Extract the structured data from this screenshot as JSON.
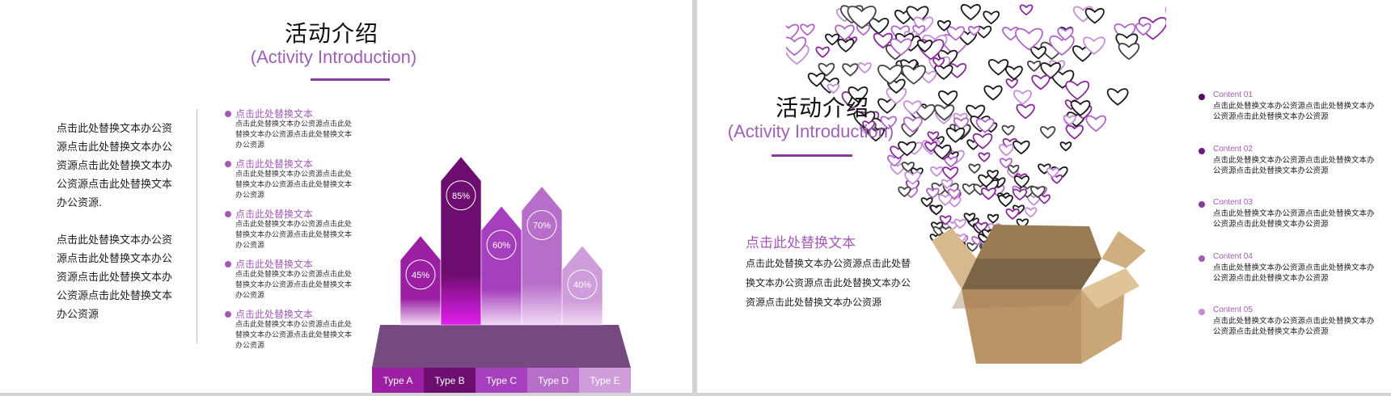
{
  "left_slide": {
    "title_cn": "活动介绍",
    "title_en": "(Activity Introduction)",
    "left_paragraphs": [
      "点击此处替换文本办公资源点击此处替换文本办公资源点击此处替换文本办公资源点击此处替换文本办公资源.",
      "点击此处替换文本办公资源点击此处替换文本办公资源点击此处替换文本办公资源点击此处替换文本办公资源"
    ],
    "bullets": [
      {
        "heading": "点击此处替换文本",
        "body": "点击此处替换文本办公资源点击此处替换文本办公资源点击此处替换文本办公资源"
      },
      {
        "heading": "点击此处替换文本",
        "body": "点击此处替换文本办公资源点击此处替换文本办公资源点击此处替换文本办公资源"
      },
      {
        "heading": "点击此处替换文本",
        "body": "点击此处替换文本办公资源点击此处替换文本办公资源点击此处替换文本办公资源"
      },
      {
        "heading": "点击此处替换文本",
        "body": "点击此处替换文本办公资源点击此处替换文本办公资源点击此处替换文本办公资源"
      },
      {
        "heading": "点击此处替换文本",
        "body": "点击此处替换文本办公资源点击此处替换文本办公资源点击此处替换文本办公资源"
      }
    ]
  },
  "chart_data": {
    "type": "bar",
    "categories": [
      "Type A",
      "Type B",
      "Type C",
      "Type D",
      "Type E"
    ],
    "values": [
      45,
      85,
      60,
      70,
      40
    ],
    "value_labels": [
      "45%",
      "85%",
      "60%",
      "70%",
      "40%"
    ],
    "ylim": [
      0,
      100
    ],
    "grid": false,
    "colors": [
      "#9b1fa3",
      "#6d0d6f",
      "#a53fbd",
      "#b76ec9",
      "#cf9dd9"
    ]
  },
  "right_slide": {
    "title_cn": "活动介绍",
    "title_en": "(Activity Introduction)",
    "sub_heading": "点击此处替换文本",
    "sub_body": "点击此处替换文本办公资源点击此处替换文本办公资源点击此处替换文本办公资源点击此处替换文本办公资源",
    "contents": [
      {
        "title": "Content 01",
        "body": "点击此处替换文本办公资源点击此处替换文本办公资源点击此处替换文本办公资源",
        "color": "#5a0a66"
      },
      {
        "title": "Content 02",
        "body": "点击此处替换文本办公资源点击此处替换文本办公资源点击此处替换文本办公资源",
        "color": "#6f1a7f"
      },
      {
        "title": "Content 03",
        "body": "点击此处替换文本办公资源点击此处替换文本办公资源点击此处替换文本办公资源",
        "color": "#8a3a9a"
      },
      {
        "title": "Content 04",
        "body": "点击此处替换文本办公资源点击此处替换文本办公资源点击此处替换文本办公资源",
        "color": "#a25cb4"
      },
      {
        "title": "Content 05",
        "body": "点击此处替换文本办公资源点击此处替换文本办公资源点击此处替换文本办公资源",
        "color": "#c38ccf"
      }
    ]
  }
}
